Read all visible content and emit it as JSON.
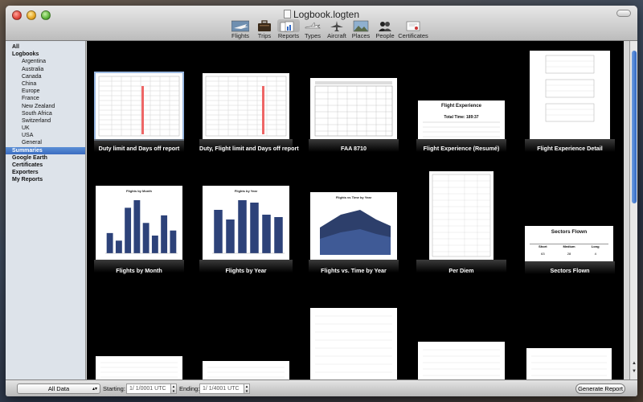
{
  "window": {
    "title": "Logbook.logten"
  },
  "toolbar": {
    "items": [
      {
        "label": "Flights",
        "icon": "plane-photo-icon"
      },
      {
        "label": "Trips",
        "icon": "suitcase-icon"
      },
      {
        "label": "Reports",
        "icon": "reports-icon"
      },
      {
        "label": "Types",
        "icon": "aircraft-type-icon"
      },
      {
        "label": "Aircraft",
        "icon": "aircraft-icon"
      },
      {
        "label": "Places",
        "icon": "places-photo-icon"
      },
      {
        "label": "People",
        "icon": "people-icon"
      },
      {
        "label": "Certificates",
        "icon": "certificate-icon"
      }
    ]
  },
  "sidebar": {
    "items": [
      {
        "label": "All"
      },
      {
        "label": "Logbooks"
      },
      {
        "label": "Argentina"
      },
      {
        "label": "Australia"
      },
      {
        "label": "Canada"
      },
      {
        "label": "China"
      },
      {
        "label": "Europe"
      },
      {
        "label": "France"
      },
      {
        "label": "New Zealand"
      },
      {
        "label": "South Africa"
      },
      {
        "label": "Switzerland"
      },
      {
        "label": "UK"
      },
      {
        "label": "USA"
      },
      {
        "label": "General"
      },
      {
        "label": "Summaries"
      },
      {
        "label": "Google Earth"
      },
      {
        "label": "Certificates"
      },
      {
        "label": "Exporters"
      },
      {
        "label": "My Reports"
      }
    ]
  },
  "reports": [
    {
      "caption": "Duty limit and Days off report"
    },
    {
      "caption": "Duty, Flight limit and Days off report"
    },
    {
      "caption": "FAA 8710"
    },
    {
      "caption": "Flight Experience (Resumé)"
    },
    {
      "caption": "Flight Experience Detail"
    },
    {
      "caption": "Flights by Month"
    },
    {
      "caption": "Flights by Year"
    },
    {
      "caption": "Flights vs. Time by Year"
    },
    {
      "caption": "Per Diem"
    },
    {
      "caption": "Sectors Flown"
    }
  ],
  "thumbs": {
    "flight_experience_title": "Flight Experience",
    "flight_experience_total": "Total Time: 189:37",
    "flights_by_month_title": "Flights by Month",
    "flights_by_month_values": [
      4,
      2.5,
      9,
      10.5,
      6,
      3.5,
      7.5,
      4.5
    ],
    "flights_by_year_title": "Flights by Year",
    "flights_by_year_values": [
      9,
      7,
      11,
      10.5,
      8,
      7.5
    ],
    "flights_vs_time_title": "Flights vs Time by Year",
    "sectors_title": "Sectors Flown",
    "sectors_cols": [
      "Short",
      "Medium",
      "Long"
    ],
    "sectors_vals": [
      "63",
      "28",
      "4"
    ],
    "faa_title": "FAA 8710"
  },
  "bottom": {
    "popup_value": "All Data",
    "starting_label": "Starting:",
    "start_date": "1/ 1/0001",
    "ending_label": "Ending:",
    "end_date": "1/ 1/4001",
    "tz": "UTC",
    "generate_label": "Generate Report"
  }
}
